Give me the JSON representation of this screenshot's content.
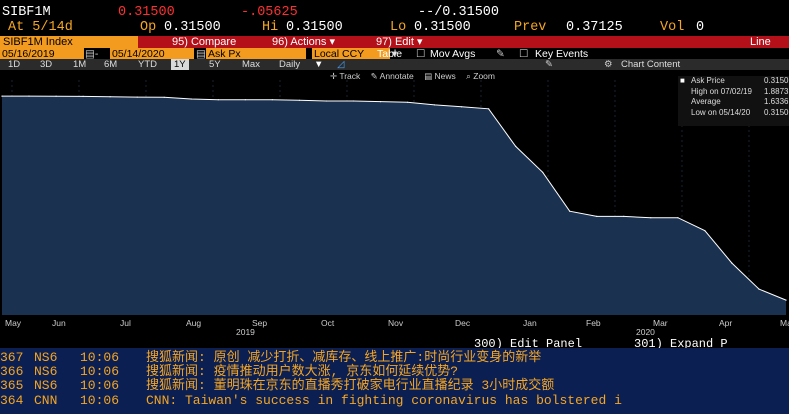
{
  "header": {
    "ticker": "SIBF1M",
    "last": "0.31500",
    "change": "-.05625",
    "bidask": "--/0.31500",
    "at": "At 5/14d",
    "op_label": "Op",
    "op": "0.31500",
    "hi_label": "Hi",
    "hi": "0.31500",
    "lo_label": "Lo",
    "lo": "0.31500",
    "prev_label": "Prev",
    "prev": "0.37125",
    "vol_label": "Vol",
    "vol": "0"
  },
  "toolbar": {
    "security": "SIBF1M Index",
    "compare": "95) Compare",
    "actions": "96) Actions ▾",
    "edit": "97) Edit ▾",
    "line": "Line"
  },
  "range": {
    "start": "05/16/2019",
    "end": "05/14/2020",
    "field": "Ask Px",
    "currency": "Local CCY",
    "table": "Table",
    "mov_avgs": "Mov Avgs",
    "key_events": "Key Events"
  },
  "periods": [
    "1D",
    "3D",
    "1M",
    "6M",
    "YTD",
    "1Y",
    "5Y",
    "Max"
  ],
  "selected_period": "1Y",
  "frequency": "Daily",
  "chart_tools": {
    "track": "Track",
    "annotate": "Annotate",
    "news": "News",
    "zoom": "Zoom",
    "chart_content": "Chart Content"
  },
  "legend": [
    {
      "label": "Ask Price",
      "value": "0.3150"
    },
    {
      "label": "High on 07/02/19",
      "value": "1.8873"
    },
    {
      "label": "Average",
      "value": "1.6336"
    },
    {
      "label": "Low on 05/14/20",
      "value": "0.3150"
    }
  ],
  "chart_data": {
    "type": "area",
    "series": [
      {
        "name": "Ask Price",
        "values": [
          1.8873,
          1.8873,
          1.887,
          1.885,
          1.883,
          1.88,
          1.878,
          1.865,
          1.86,
          1.86,
          1.86,
          1.855,
          1.85,
          1.85,
          1.845,
          1.84,
          1.82,
          1.805,
          1.79,
          1.5,
          1.3,
          1.0,
          0.96,
          0.96,
          0.95,
          0.95,
          0.85,
          0.6,
          0.4,
          0.315
        ]
      }
    ],
    "x_labels": [
      "May",
      "Jun",
      "Jul",
      "Aug",
      "Sep",
      "Oct",
      "Nov",
      "Dec",
      "Jan",
      "Feb",
      "Mar",
      "Apr",
      "May"
    ],
    "years": [
      "2019",
      "2020"
    ],
    "fill": "#1a3150",
    "line": "#ffffff",
    "grid": true
  },
  "edit_panel": {
    "edit": "300) Edit Panel",
    "expand": "301) Expand P"
  },
  "news": [
    {
      "id": "367",
      "src": "NS6",
      "time": "10:06",
      "text": "搜狐新闻: 原创 减少打折、减库存、线上推广:时尚行业变身的新举"
    },
    {
      "id": "366",
      "src": "NS6",
      "time": "10:06",
      "text": "搜狐新闻: 疫情推动用户数大涨, 京东如何延续优势?"
    },
    {
      "id": "365",
      "src": "NS6",
      "time": "10:06",
      "text": "搜狐新闻: 董明珠在京东的直播秀打破家电行业直播纪录 3小时成交额"
    },
    {
      "id": "364",
      "src": "CNN",
      "time": "10:06",
      "text": "CNN: Taiwan's success in fighting coronavirus has bolstered i"
    }
  ]
}
